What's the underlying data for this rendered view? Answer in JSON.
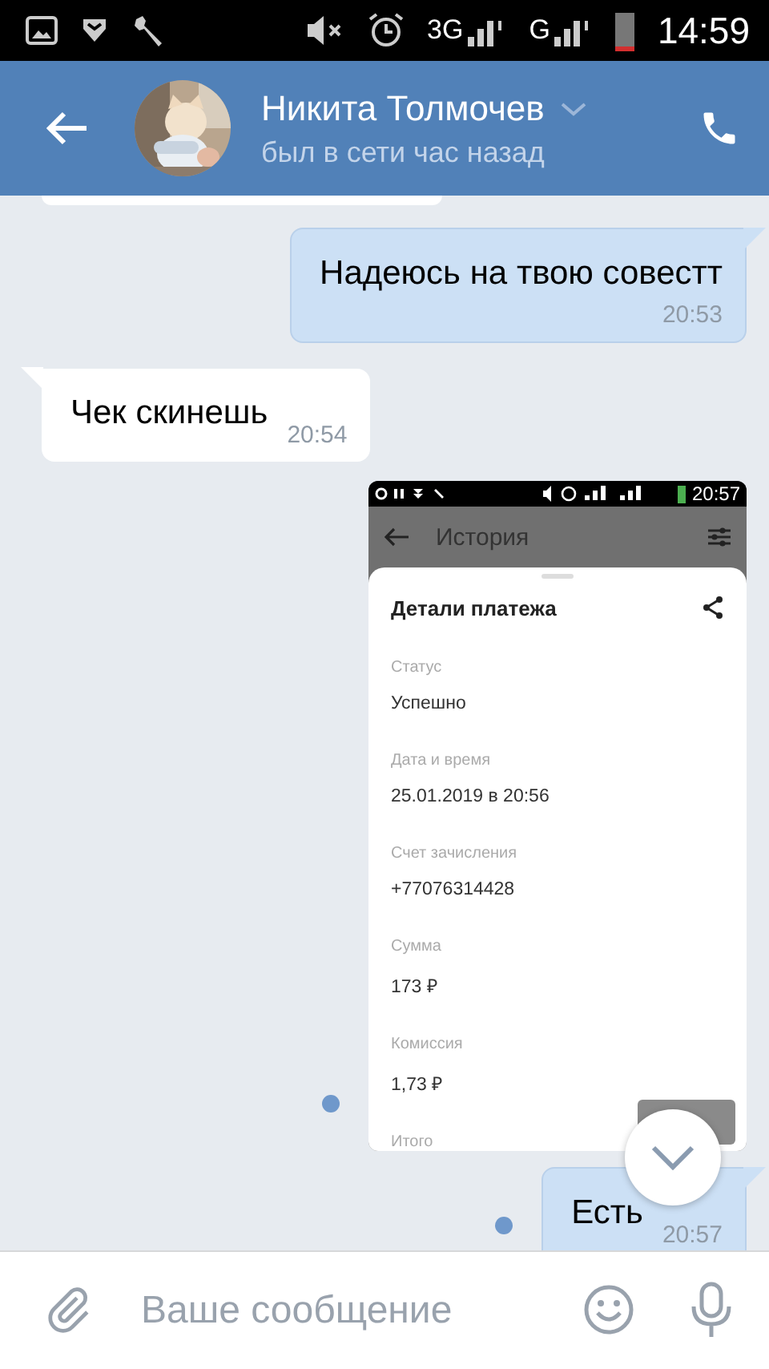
{
  "status_bar": {
    "network_1": "3G",
    "network_2": "G",
    "time": "14:59"
  },
  "header": {
    "name": "Никита Толмочев",
    "status": "был в сети час назад"
  },
  "messages": [
    {
      "kind": "stub",
      "outgoing": false
    },
    {
      "kind": "text",
      "outgoing": true,
      "text": "Надеюсь на твою совестт",
      "time": "20:53",
      "unread": false
    },
    {
      "kind": "text",
      "outgoing": false,
      "text": "Чек скинешь",
      "time": "20:54",
      "unread": false
    },
    {
      "kind": "screenshot",
      "outgoing": true,
      "unread": true,
      "shot": {
        "status_time": "20:57",
        "title": "История",
        "sheet_title": "Детали платежа",
        "fields": [
          {
            "label": "Статус",
            "value": "Успешно"
          },
          {
            "label": "Дата и время",
            "value": "25.01.2019 в 20:56"
          },
          {
            "label": "Счет зачисления",
            "value": "+77076314428"
          },
          {
            "label": "Сумма",
            "value": "173 ₽"
          },
          {
            "label": "Комиссия",
            "value": "1,73 ₽"
          },
          {
            "label": "Итого"
          }
        ]
      }
    },
    {
      "kind": "text",
      "outgoing": true,
      "text": "Есть",
      "time": "20:57",
      "unread": true
    }
  ],
  "composer": {
    "placeholder": "Ваше сообщение"
  }
}
